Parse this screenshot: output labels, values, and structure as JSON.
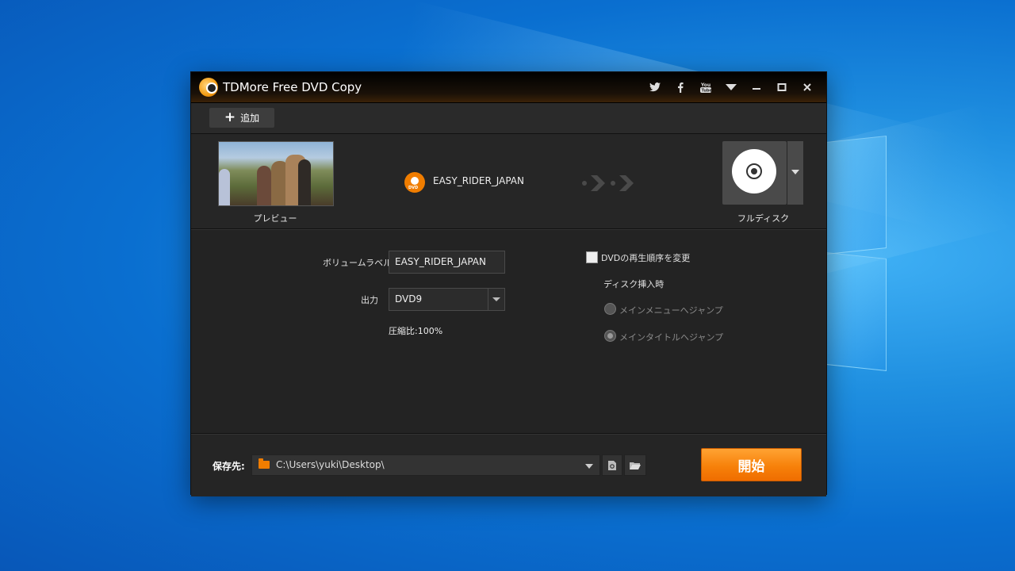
{
  "window": {
    "title": "TDMore Free DVD Copy"
  },
  "titlebar_icons": [
    "twitter-icon",
    "facebook-icon",
    "youtube-icon",
    "menu-dropdown-icon",
    "minimize-icon",
    "maximize-icon",
    "close-icon"
  ],
  "toolbar": {
    "add_label": "追加"
  },
  "source": {
    "preview_label": "プレビュー",
    "disc_badge": "DVD",
    "disc_name": "EASY_RIDER_JAPAN",
    "target_label": "フルディスク"
  },
  "settings": {
    "volume_label_caption": "ボリュームラベル",
    "volume_label_value": "EASY_RIDER_JAPAN",
    "output_caption": "出力",
    "output_value": "DVD9",
    "compression": "圧縮比:100%",
    "change_order_label": "DVDの再生順序を変更",
    "change_order_checked": false,
    "on_insert_caption": "ディスク挿入時",
    "radio_main_menu": "メインメニューへジャンプ",
    "radio_main_title": "メインタイトルへジャンプ",
    "selected_radio": "main_title"
  },
  "footer": {
    "save_to_label": "保存先:",
    "path": "C:\\Users\\yuki\\Desktop\\",
    "start_label": "開始"
  },
  "colors": {
    "accent": "#f7810a",
    "window_bg": "#252525",
    "titlebar": "#000000"
  }
}
